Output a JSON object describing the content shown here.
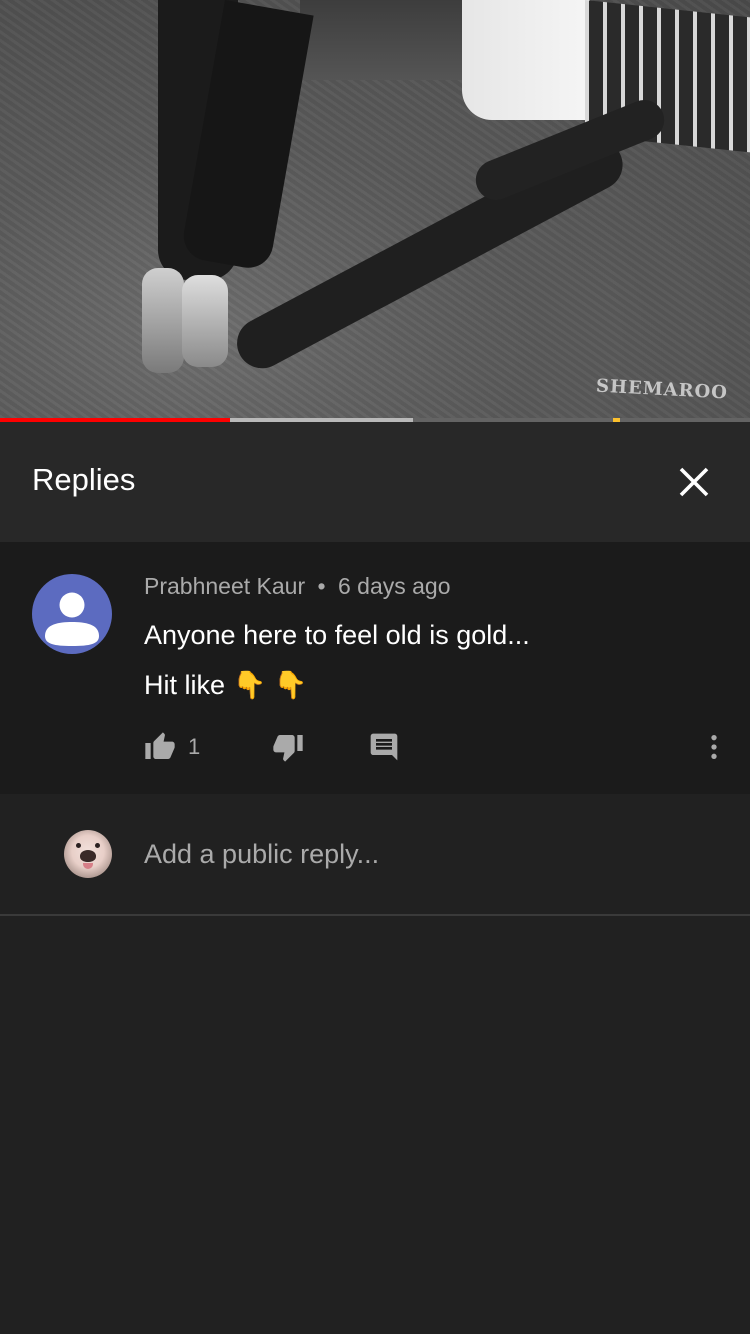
{
  "video": {
    "watermark": "SHEMAROO",
    "progress": {
      "played": 0.307,
      "buffered": 0.55,
      "ad_markers": [
        0.817
      ]
    },
    "colors": {
      "played": "#ff0000",
      "ad_marker": "#fbc02d"
    }
  },
  "replies_header": {
    "title": "Replies",
    "close_icon": "close-icon"
  },
  "comment": {
    "author": "Prabhneet Kaur",
    "separator": "•",
    "time": "6 days ago",
    "lines": [
      "Anyone here to feel old is gold...",
      "Hit like 👇 👇"
    ],
    "like_count": "1",
    "avatar_color": "#5c6bc0",
    "icons": [
      "thumbs-up-icon",
      "thumbs-down-icon",
      "reply-icon",
      "more-vert-icon"
    ]
  },
  "add_reply": {
    "placeholder": "Add a public reply..."
  },
  "theme": {
    "background": "#212121",
    "header_bg": "#282828",
    "comment_bg": "#1b1b1b",
    "secondary_text": "#aaaaaa"
  }
}
